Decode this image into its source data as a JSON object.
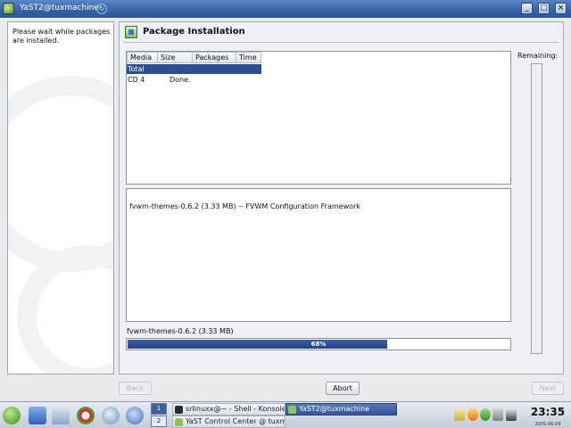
{
  "window": {
    "title": "YaST2@tuxmachine"
  },
  "help": {
    "text": "Please wait while packages are installed."
  },
  "header": {
    "title": "Package Installation"
  },
  "media_table": {
    "columns": [
      "Media",
      "Size",
      "Packages",
      "Time"
    ],
    "rows": [
      {
        "media": "Total",
        "size": "",
        "packages": "",
        "time": "",
        "selected": true
      },
      {
        "media": "CD 4",
        "size": "Done.",
        "packages": "",
        "time": "",
        "selected": false
      }
    ]
  },
  "description": {
    "text": "fvwm-themes-0.6.2 (3.33 MB) -- FVWM Configuration Framework"
  },
  "progress": {
    "label": "fvwm-themes-0.6.2 (3.33 MB)",
    "percent": 68,
    "percent_text": "68%"
  },
  "remaining": {
    "label": "Remaining:"
  },
  "buttons": {
    "back": "Back",
    "abort": "Abort",
    "next": "Next"
  },
  "taskbar": {
    "desktops": [
      "1",
      "2"
    ],
    "tasks": [
      {
        "label": "srlinuxx@~ - Shell - Konsole",
        "active": false
      },
      {
        "label": "YaST2@tuxmachine",
        "active": true
      },
      {
        "label": "YaST Control Center @ tuxmachine",
        "active": false
      }
    ],
    "clock": "23:35",
    "date": "2005-06-09"
  },
  "colors": {
    "titlebar": "#3562a6",
    "selection": "#2c4f93",
    "progress_fill": "#2b4b91"
  }
}
